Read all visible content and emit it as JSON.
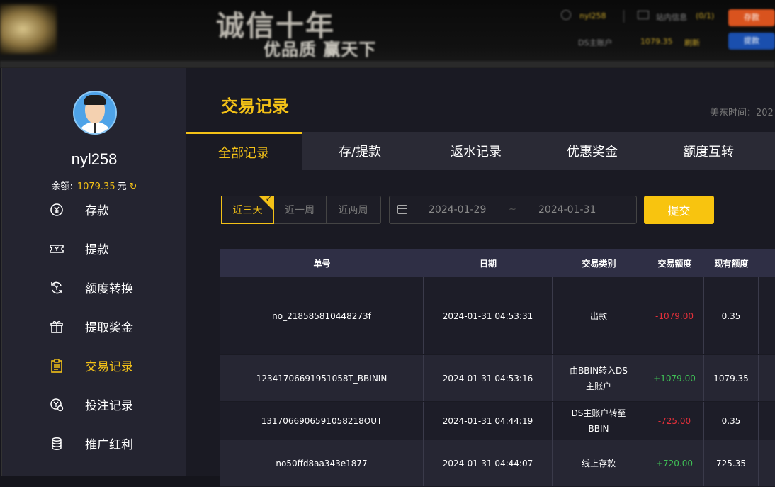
{
  "banner": {
    "slogan_main": "诚信十年",
    "slogan_sub": "优品质  赢天下",
    "username": "nyl258",
    "messages_label": "站内信息",
    "messages_count": "(0/1)",
    "btn_top": "存款",
    "btn_bottom": "提款",
    "account_label": "DS主账户",
    "account_balance": "1079.35",
    "refresh_label": "刷新"
  },
  "sidebar": {
    "username": "nyl258",
    "balance_label": "余额:",
    "balance_value": "1079.35",
    "balance_unit": "元",
    "menu": [
      {
        "label": "存款",
        "icon": "yen-circle-icon"
      },
      {
        "label": "提款",
        "icon": "ticket-icon"
      },
      {
        "label": "额度转换",
        "icon": "exchange-icon"
      },
      {
        "label": "提取奖金",
        "icon": "gift-icon"
      },
      {
        "label": "交易记录",
        "icon": "clipboard-icon",
        "active": true
      },
      {
        "label": "投注记录",
        "icon": "bet-record-icon"
      },
      {
        "label": "推广红利",
        "icon": "coins-icon"
      }
    ]
  },
  "main": {
    "title": "交易记录",
    "time_label": "美东时间：202",
    "tabs": [
      "全部记录",
      "存/提款",
      "返水记录",
      "优惠奖金",
      "额度互转"
    ],
    "active_tab": 0
  },
  "filters": {
    "quick_ranges": [
      "近三天",
      "近一周",
      "近两周"
    ],
    "active_range": 0,
    "date_start": "2024-01-29",
    "date_separator": "~",
    "date_end": "2024-01-31",
    "submit_label": "提交"
  },
  "table": {
    "headers": [
      "单号",
      "日期",
      "交易类别",
      "交易额度",
      "现有额度"
    ],
    "rows": [
      {
        "id": "no_218585810448273f",
        "date": "2024-01-31 04:53:31",
        "type": "出款",
        "amount": "-1079.00",
        "balance": "0.35"
      },
      {
        "id": "12341706691951058T_BBININ",
        "date": "2024-01-31 04:53:16",
        "type": "由BBIN转入DS主账户",
        "amount": "+1079.00",
        "balance": "1079.35"
      },
      {
        "id": "1317066906591058218OUT",
        "date": "2024-01-31 04:44:19",
        "type": "DS主账户转至BBIN",
        "amount": "-725.00",
        "balance": "0.35"
      },
      {
        "id": "no50ffd8aa343e1877",
        "date": "2024-01-31 04:44:07",
        "type": "线上存款",
        "amount": "+720.00",
        "balance": "725.35"
      }
    ]
  },
  "colors": {
    "accent": "#f3c117",
    "negative": "#e5303a",
    "positive": "#3fbf55",
    "sidebar_bg": "#242430",
    "main_bg": "#1a1a23"
  }
}
